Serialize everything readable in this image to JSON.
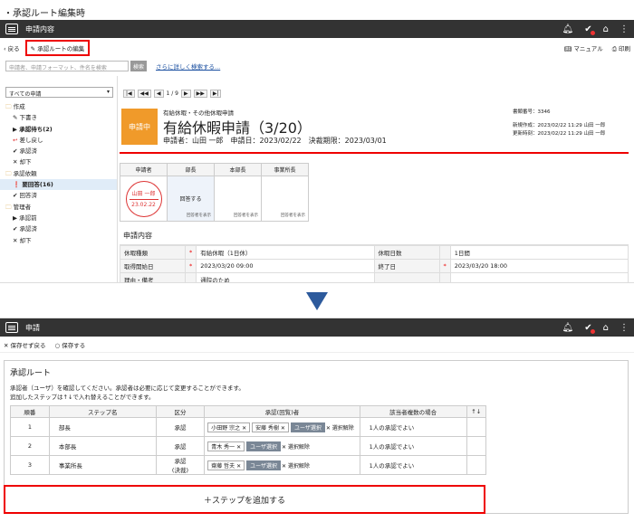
{
  "caption": "・承認ルート編集時",
  "top": {
    "bar_title": "申請内容",
    "toolbar": {
      "back": "戻る",
      "edit_route": "承認ルートの編集",
      "manual": "マニュアル",
      "print": "印刷"
    },
    "search": {
      "placeholder": "申請者、申請フォーマット、件名を検索",
      "button": "検索",
      "advanced_link": "さらに詳しく検索する..."
    },
    "filter_select": "すべての申請",
    "tree": [
      {
        "label": "作成",
        "icon": "folder-icon",
        "sub": false
      },
      {
        "label": "下書き",
        "icon": "pencil-icon",
        "sub": true
      },
      {
        "label": "承認待ち(2)",
        "icon": "play-icon",
        "sub": true,
        "bold": true
      },
      {
        "label": "差し戻し",
        "icon": "return-icon",
        "sub": true
      },
      {
        "label": "承認済",
        "icon": "check-icon",
        "sub": true
      },
      {
        "label": "却下",
        "icon": "x-icon",
        "sub": true
      },
      {
        "label": "承認依頼",
        "icon": "folder-icon",
        "sub": false
      },
      {
        "label": "要回答(16)",
        "icon": "exclamation-icon",
        "sub": true,
        "bold": true,
        "highlight": true
      },
      {
        "label": "回答済",
        "icon": "check-icon",
        "sub": true
      },
      {
        "label": "管理者",
        "icon": "folder-icon",
        "sub": false
      },
      {
        "label": "承認前",
        "icon": "play-icon",
        "sub": true
      },
      {
        "label": "承認済",
        "icon": "check-icon",
        "sub": true
      },
      {
        "label": "却下",
        "icon": "x-icon",
        "sub": true
      }
    ],
    "pager": {
      "first": "|◀",
      "prev_prev": "◀◀",
      "prev": "◀",
      "text": "1 / 9",
      "next": "▶",
      "next_next": "▶▶",
      "last": "▶|"
    },
    "doc": {
      "status": "申請中",
      "category": "有給休暇・その他休暇申請",
      "title": "有給休暇申請（3/20）",
      "meta": "申請者：山田 一郎　申請日：2023/02/22　決裁期限：2023/03/01",
      "doc_no": "書類番号：3346",
      "created": "新規作成：2023/02/22 11:29 山田 一郎",
      "updated": "更新時刻：2023/02/22 11:29 山田 一郎"
    },
    "approval": {
      "headers": [
        "申請者",
        "部長",
        "本部長",
        "事業所長"
      ],
      "stamp_name": "山田 一郎",
      "stamp_date": "23.02.22",
      "answer": "回答する",
      "show_approver": "回答者を表示"
    },
    "section_title": "申請内容",
    "fields": [
      {
        "label": "休暇種類",
        "required": true,
        "value": "有給休暇（1日休）",
        "label2": "休暇日数",
        "required2": false,
        "value2": "1日間"
      },
      {
        "label": "取得開始日",
        "required": true,
        "value": "2023/03/20 09:00",
        "label2": "終了日",
        "required2": true,
        "value2": "2023/03/20 18:00"
      },
      {
        "label": "理由・備考",
        "required": false,
        "value": "通院のため",
        "label2": "",
        "required2": false,
        "value2": ""
      }
    ]
  },
  "bottom": {
    "bar_title": "申請",
    "toolbar": {
      "cancel": "保存せず戻る",
      "save": "保存する"
    },
    "route_title": "承認ルート",
    "desc1": "承認者（ユーザ）を確認してください。承認者は必要に応じて変更することができます。",
    "desc2": "追加したステップは↑↓で入れ替えることができます。",
    "headers": [
      "順番",
      "ステップ名",
      "区分",
      "承認(回覧)者",
      "該当者複数の場合",
      "↑↓"
    ],
    "rows": [
      {
        "order": "1",
        "step": "部長",
        "type": "承認",
        "approvers": [
          "小田野 宗之 ✕",
          "安藤 秀樹 ✕"
        ],
        "user_select": "ユーザ選択",
        "clear": "✕ 選択解除",
        "multi": "1人の承認でよい"
      },
      {
        "order": "2",
        "step": "本部長",
        "type": "承認",
        "approvers": [
          "青木 秀一 ✕"
        ],
        "user_select": "ユーザ選択",
        "clear": "✕ 選択解除",
        "multi": "1人の承認でよい"
      },
      {
        "order": "3",
        "step": "事業所長",
        "type": "承認\n(決裁)",
        "approvers": [
          "齋藤 哲夫 ✕"
        ],
        "user_select": "ユーザ選択",
        "clear": "✕ 選択解除",
        "multi": "1人の承認でよい"
      }
    ],
    "add_step": "＋ステップを追加する"
  },
  "colors": {
    "accent_red": "#e00000",
    "status_orange": "#f09a2a",
    "arrow_blue": "#2d5a9c",
    "bar_dark": "#333333"
  }
}
